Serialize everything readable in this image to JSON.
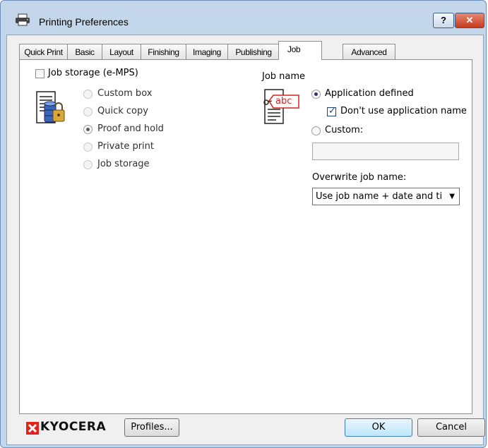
{
  "window": {
    "title": "Printing Preferences",
    "help_label": "?",
    "close_label": "✕"
  },
  "tabs": [
    {
      "label": "Quick Print",
      "active": false
    },
    {
      "label": "Basic",
      "active": false
    },
    {
      "label": "Layout",
      "active": false
    },
    {
      "label": "Finishing",
      "active": false
    },
    {
      "label": "Imaging",
      "active": false
    },
    {
      "label": "Publishing",
      "active": false
    },
    {
      "label": "Job",
      "active": true
    },
    {
      "label": "Advanced",
      "active": false
    }
  ],
  "job_storage": {
    "checkbox_label": "Job storage (e-MPS)",
    "checked": false,
    "icon": "document-database-lock-icon",
    "options": [
      {
        "label": "Custom box",
        "selected": false
      },
      {
        "label": "Quick copy",
        "selected": false
      },
      {
        "label": "Proof and hold",
        "selected": true
      },
      {
        "label": "Private print",
        "selected": false
      },
      {
        "label": "Job storage",
        "selected": false
      }
    ]
  },
  "job_name": {
    "heading": "Job name",
    "icon": "document-tag-abc-icon",
    "icon_text": "abc",
    "application_defined_label": "Application defined",
    "application_defined_selected": true,
    "dont_use_app_name_label": "Don't use application name",
    "dont_use_app_name_checked": true,
    "custom_label": "Custom:",
    "custom_selected": false,
    "custom_value": "",
    "overwrite_label": "Overwrite job name:",
    "overwrite_value": "Use job name + date and ti"
  },
  "footer": {
    "brand": "KYOCERA",
    "profiles_label": "Profiles...",
    "ok_label": "OK",
    "cancel_label": "Cancel"
  },
  "colors": {
    "brand_red": "#e2231a",
    "title_bar": "#c4d6ea",
    "default_button": "#bee6fd"
  }
}
